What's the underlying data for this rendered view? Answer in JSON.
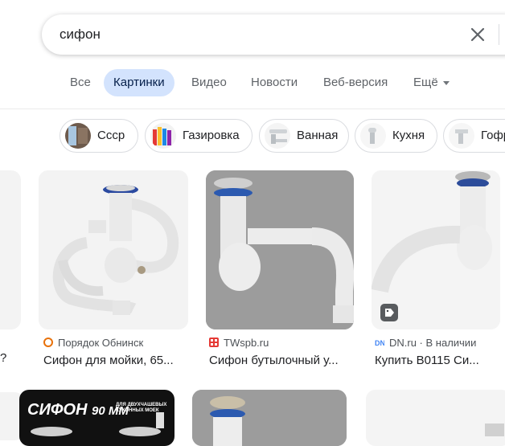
{
  "search": {
    "query": "сифон",
    "clear_icon": "close-icon"
  },
  "tabs": [
    {
      "label": "Все"
    },
    {
      "label": "Картинки"
    },
    {
      "label": "Видео"
    },
    {
      "label": "Новости"
    },
    {
      "label": "Веб-версия"
    },
    {
      "label": "Ещё"
    }
  ],
  "chips": [
    {
      "label": "Ссср"
    },
    {
      "label": "Газировка"
    },
    {
      "label": "Ванная"
    },
    {
      "label": "Кухня"
    },
    {
      "label": "Гофр"
    }
  ],
  "results": [
    {
      "source": "Порядок Обнинск",
      "title": "Сифон для мойки, 65..."
    },
    {
      "source": "TWspb.ru",
      "title": "Сифон бутылочный у..."
    },
    {
      "source": "DN.ru · В наличии",
      "title": "Купить B0115 Си..."
    }
  ],
  "row2_banner": {
    "big": "СИФОН",
    "size": "90 ММ",
    "subtitle_line1": "ДЛЯ ДВУХЧАШЕВЫХ",
    "subtitle_line2": "КУХОННЫХ МОЕК"
  },
  "colors": {
    "active_tab_bg": "#d3e3fd",
    "active_tab_text": "#041e49",
    "secondary_text": "#5f6368",
    "twspb_red": "#e53935",
    "dn_blue": "#4285f4"
  }
}
